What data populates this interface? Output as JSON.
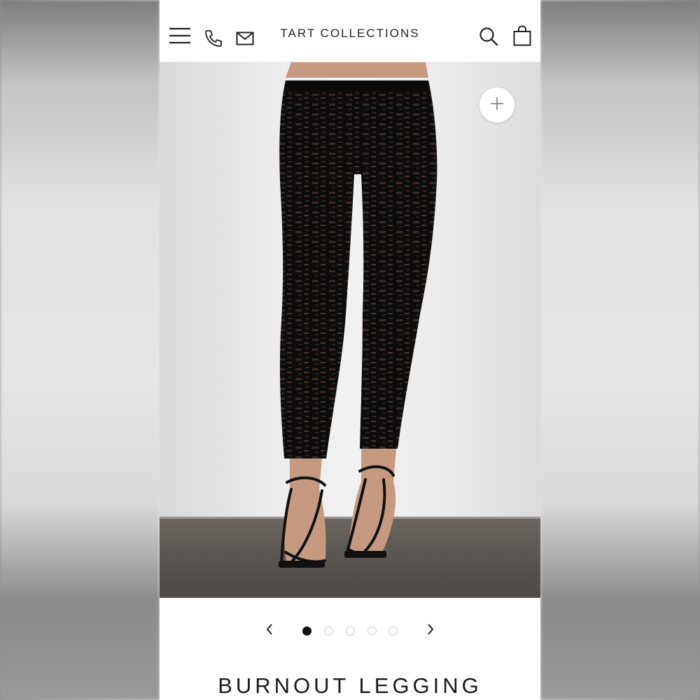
{
  "header": {
    "brand": "TART COLLECTIONS",
    "icons": [
      "menu-icon",
      "phone-icon",
      "mail-icon",
      "search-icon",
      "bag-icon"
    ]
  },
  "gallery": {
    "zoom_icon": "plus-icon",
    "slide_count": 5,
    "active_slide": 1,
    "prev_icon": "chevron-left-icon",
    "next_icon": "chevron-right-icon"
  },
  "product": {
    "title": "BURNOUT LEGGING"
  },
  "colors": {
    "accent": "#111111",
    "background": "#ffffff"
  }
}
